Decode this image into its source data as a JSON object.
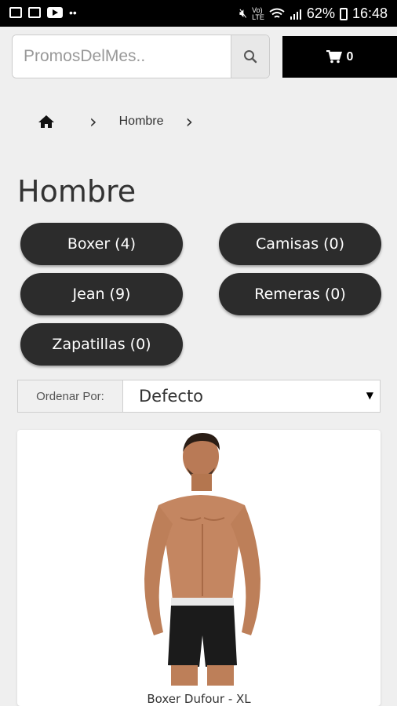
{
  "status_bar": {
    "left_icons": [
      "gallery-icon",
      "calendar-icon",
      "youtube-icon",
      "more-dots-icon"
    ],
    "right_icons": [
      "mute-icon",
      "volte-icon",
      "wifi-icon",
      "signal-icon",
      "battery-icon"
    ],
    "battery": "62%",
    "time": "16:48"
  },
  "search": {
    "placeholder": "PromosDelMes.."
  },
  "cart": {
    "count": "0"
  },
  "breadcrumb": {
    "current": "Hombre"
  },
  "page_title": "Hombre",
  "categories": [
    {
      "label": "Boxer (4)"
    },
    {
      "label": "Camisas (0)"
    },
    {
      "label": "Jean (9)"
    },
    {
      "label": "Remeras (0)"
    },
    {
      "label": "Zapatillas (0)"
    }
  ],
  "sort": {
    "label": "Ordenar Por:",
    "value": "Defecto"
  },
  "product": {
    "name": "Boxer Dufour - XL"
  }
}
